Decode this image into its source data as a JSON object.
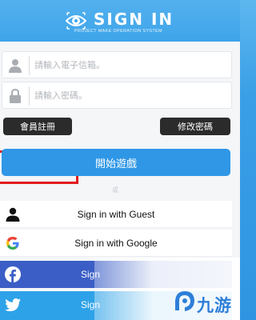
{
  "header": {
    "title": "SIGN IN",
    "subtitle": "PROJECT MAKE OPERATION SYSTEM"
  },
  "form": {
    "email_placeholder": "請輸入電子信箱。",
    "password_placeholder": "請輸入密碼。",
    "register_label": "會員註冊",
    "change_password_label": "修改密碼",
    "start_label": "開始遊戲",
    "or_text": "或"
  },
  "sso": {
    "guest_label": "Sign in with Guest",
    "google_label": "Sign in with Google",
    "facebook_label": "Sign",
    "twitter_label": "Sign"
  },
  "watermark": {
    "text": "九游"
  },
  "colors": {
    "accent": "#2f97e6",
    "highlight": "#e31b1b",
    "facebook": "#3b5ec6",
    "twitter": "#2ea2e8"
  }
}
